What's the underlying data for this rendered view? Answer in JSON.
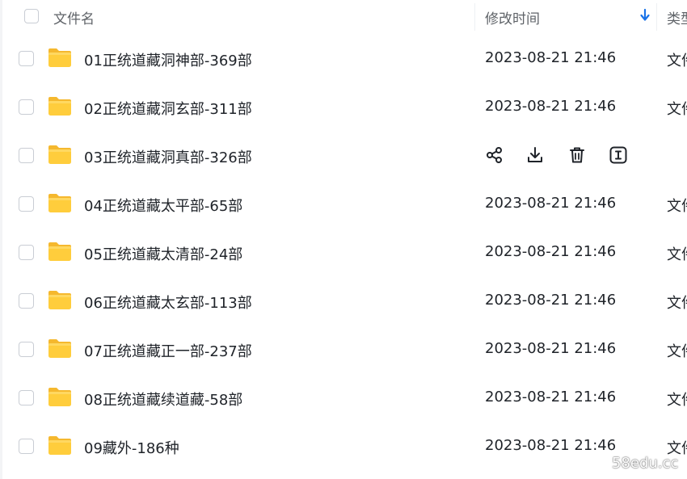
{
  "header": {
    "name_label": "文件名",
    "time_label": "修改时间",
    "type_label": "类型"
  },
  "rows": [
    {
      "name": "01正统道藏洞神部-369部",
      "time": "2023-08-21 21:46",
      "type": "文件夹"
    },
    {
      "name": "02正统道藏洞玄部-311部",
      "time": "2023-08-21 21:46",
      "type": "文件夹"
    },
    {
      "name": "03正统道藏洞真部-326部",
      "time": "",
      "type": ""
    },
    {
      "name": "04正统道藏太平部-65部",
      "time": "2023-08-21 21:46",
      "type": "文件夹"
    },
    {
      "name": "05正统道藏太清部-24部",
      "time": "2023-08-21 21:46",
      "type": "文件夹"
    },
    {
      "name": "06正统道藏太玄部-113部",
      "time": "2023-08-21 21:46",
      "type": "文件夹"
    },
    {
      "name": "07正统道藏正一部-237部",
      "time": "2023-08-21 21:46",
      "type": "文件夹"
    },
    {
      "name": "08正统道藏续道藏-58部",
      "time": "2023-08-21 21:46",
      "type": "文件夹"
    },
    {
      "name": "09藏外-186种",
      "time": "2023-08-21 21:46",
      "type": "文件夹"
    }
  ],
  "hover_actions": {
    "icons": [
      "share-icon",
      "download-icon",
      "trash-icon",
      "rename-icon"
    ]
  },
  "watermark": "58edu.cc",
  "colors": {
    "folder_yellow": "#FFC940",
    "sort_blue": "#1A73E8",
    "text": "#1F2329",
    "muted": "#5F6368"
  }
}
